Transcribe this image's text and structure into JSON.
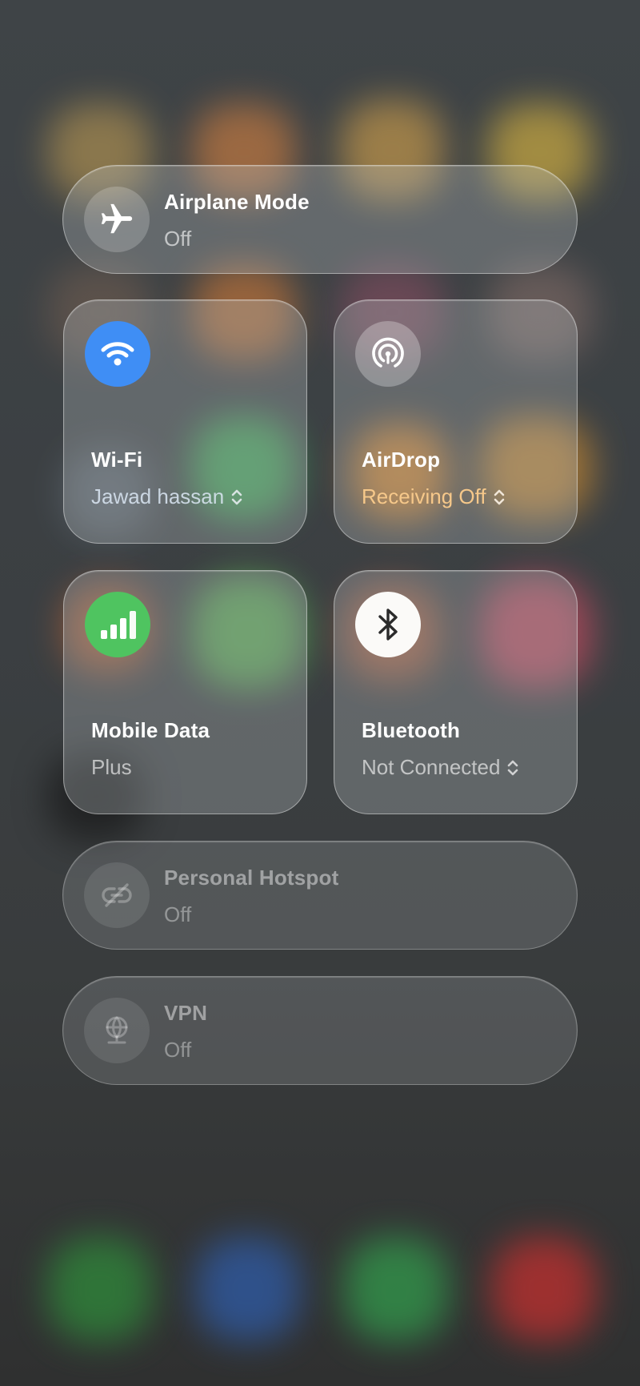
{
  "tiles": {
    "airplane": {
      "title": "Airplane Mode",
      "status": "Off",
      "icon": "airplane-icon"
    },
    "wifi": {
      "title": "Wi-Fi",
      "status": "Jawad hassan",
      "icon": "wifi-icon",
      "color": "#3f8ef5"
    },
    "airdrop": {
      "title": "AirDrop",
      "status": "Receiving Off",
      "icon": "airdrop-icon",
      "status_color": "#f6c88a"
    },
    "mobile_data": {
      "title": "Mobile Data",
      "status": "Plus",
      "icon": "cellular-signal-icon",
      "color": "#4fc460"
    },
    "bluetooth": {
      "title": "Bluetooth",
      "status": "Not Connected",
      "icon": "bluetooth-icon"
    },
    "hotspot": {
      "title": "Personal Hotspot",
      "status": "Off",
      "icon": "hotspot-link-icon"
    },
    "vpn": {
      "title": "VPN",
      "status": "Off",
      "icon": "vpn-globe-icon"
    }
  }
}
